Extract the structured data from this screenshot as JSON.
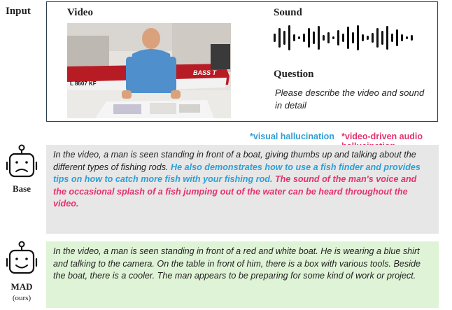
{
  "input": {
    "label": "Input",
    "video_label": "Video",
    "sound_label": "Sound",
    "question_label": "Question",
    "question_text": "Please describe the video and sound in detail"
  },
  "video_frame": {
    "boat_text": "BASS T",
    "boat_number": "L 8607 KF"
  },
  "legend": {
    "visual": "*visual hallucination",
    "audio": "*video-driven audio hallucination",
    "visual_color": "#2e9fd6",
    "audio_color": "#e5326f"
  },
  "base": {
    "robot_label": "Base",
    "robot_icon": "sad-robot-icon",
    "text_normal": "In the video, a man is seen standing in front of a boat, giving thumbs up and talking about the different types of fishing rods. ",
    "text_visual": "He also demonstrates how to use a fish finder and provides tips on how to catch more fish with your fishing rod. ",
    "text_audio": "The sound of the man's voice and the occasional splash of a fish jumping out of the water can be heard throughout the video."
  },
  "mad": {
    "robot_label": "MAD",
    "robot_sub": "(ours)",
    "robot_icon": "happy-robot-icon",
    "text": "In the video, a man is seen standing in front of a red and white boat. He is wearing a blue shirt and talking to the camera. On the table in front of him, there is a box with various tools. Beside the boat, there is a cooler. The man appears to be preparing for some kind of work or project."
  }
}
